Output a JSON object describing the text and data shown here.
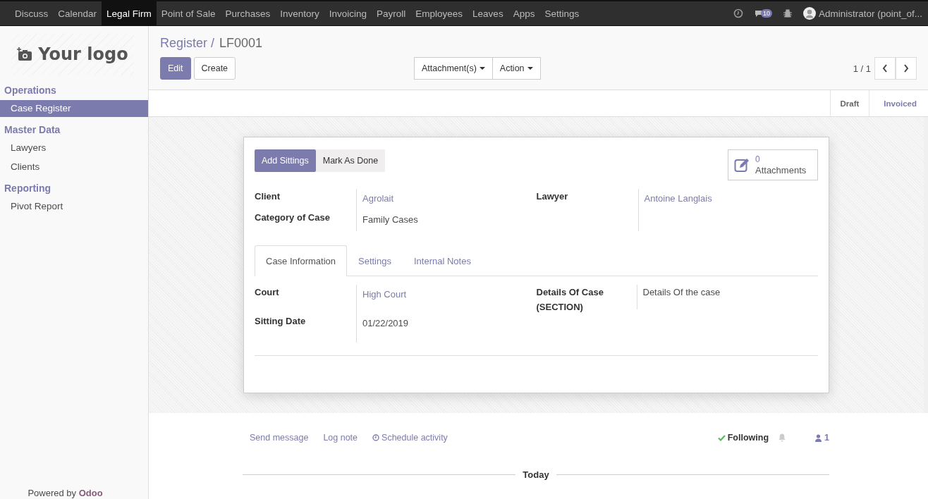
{
  "top_menu": {
    "items": [
      {
        "label": "Discuss",
        "selected": false
      },
      {
        "label": "Calendar",
        "selected": false
      },
      {
        "label": "Legal Firm",
        "selected": true
      },
      {
        "label": "Point of Sale",
        "selected": false
      },
      {
        "label": "Purchases",
        "selected": false
      },
      {
        "label": "Inventory",
        "selected": false
      },
      {
        "label": "Invoicing",
        "selected": false
      },
      {
        "label": "Payroll",
        "selected": false
      },
      {
        "label": "Employees",
        "selected": false
      },
      {
        "label": "Leaves",
        "selected": false
      },
      {
        "label": "Apps",
        "selected": false
      },
      {
        "label": "Settings",
        "selected": false
      }
    ],
    "messages_badge": "10",
    "user": "Administrator (point_of..."
  },
  "sidebar": {
    "logo": "Your logo",
    "sections": [
      {
        "title": "Operations",
        "items": [
          {
            "label": "Case Register",
            "selected": true
          }
        ]
      },
      {
        "title": "Master Data",
        "items": [
          {
            "label": "Lawyers",
            "selected": false
          },
          {
            "label": "Clients",
            "selected": false
          }
        ]
      },
      {
        "title": "Reporting",
        "items": [
          {
            "label": "Pivot Report",
            "selected": false
          }
        ]
      }
    ],
    "footer": {
      "text": "Powered by",
      "brand": "Odoo"
    }
  },
  "breadcrumb": {
    "parent": "Register",
    "separator": "/",
    "current": "LF0001"
  },
  "buttons": [
    {
      "label": "Edit",
      "kind": "primary"
    },
    {
      "label": "Create",
      "kind": "secondary"
    }
  ],
  "dropdowns": [
    "Attachment(s)",
    "Action"
  ],
  "pager": "1 / 1",
  "status_bar": {
    "stages": [
      {
        "label": "Draft",
        "selected": false
      },
      {
        "label": "Invoiced",
        "selected": true
      }
    ]
  },
  "sheet": {
    "header_buttons": [
      {
        "label": "Add Sittings",
        "kind": "primary"
      },
      {
        "label": "Mark As Done",
        "kind": "secondary"
      }
    ],
    "attachments": {
      "count": "0",
      "label": "Attachments"
    },
    "left_fields": [
      {
        "label": "Client",
        "value": "Agrolait",
        "link": true
      },
      {
        "label": "Category of Case",
        "value": "Family Cases",
        "link": false
      }
    ],
    "right_fields": [
      {
        "label": "Lawyer",
        "value": "Antoine Langlais",
        "link": true
      }
    ],
    "tabs": [
      {
        "label": "Case Information",
        "selected": true
      },
      {
        "label": "Settings",
        "selected": false
      },
      {
        "label": "Internal Notes",
        "selected": false
      }
    ],
    "tab_left_fields": [
      {
        "label": "Court",
        "value": "High Court",
        "link": true
      },
      {
        "label": "Sitting Date",
        "value": "01/22/2019",
        "link": false
      }
    ],
    "tab_right_fields": [
      {
        "label": "Details Of Case (SECTION)",
        "value": "Details Of the case",
        "link": false
      }
    ]
  },
  "chatter": {
    "actions": [
      {
        "label": "Send message",
        "kind": "plain"
      },
      {
        "label": "Log note",
        "kind": "plain"
      },
      {
        "label": "Schedule activity",
        "kind": "clock"
      }
    ],
    "following": {
      "label": "Following",
      "checked": true
    },
    "followers": "1",
    "divider": "Today"
  }
}
